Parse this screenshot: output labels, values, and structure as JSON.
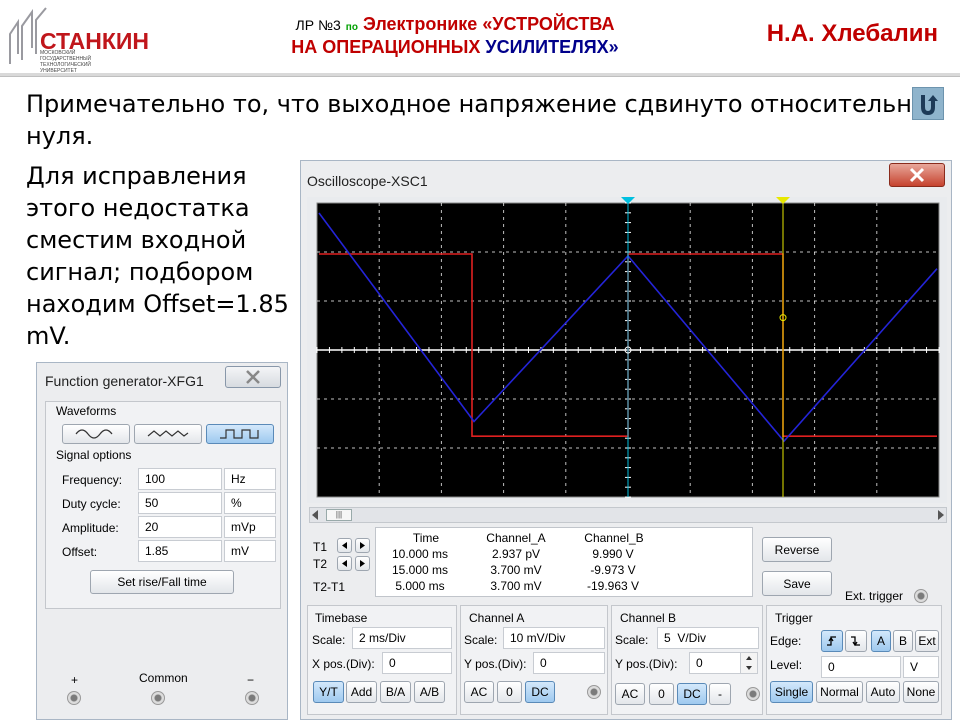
{
  "header": {
    "logo_text": "СТАНКИН",
    "logo_subtitle": "МОСКОВСКИЙ ГОСУДАРСТВЕННЫЙ ТЕХНОЛОГИЧЕСКИЙ УНИВЕРСИТЕТ",
    "lr": "ЛР №3",
    "po": "по",
    "subject": "Электронике",
    "title_part1": "«УСТРОЙСТВА",
    "title_part2a": "НА ОПЕРАЦИОННЫХ",
    "title_part2b": "УСИЛИТЕЛЯХ»",
    "author": "Н.А. Хлебалин"
  },
  "body": {
    "line1": "Примечательно то, что выходное напряжение сдвинуто относительно",
    "line2": "нуля.",
    "side_lines": [
      "Для исправления",
      "этого недостатка",
      "сместим входной",
      "сигнал; подбором",
      "находим Offset=1.85",
      "mV."
    ]
  },
  "function_generator": {
    "title": "Function generator-XFG1",
    "waveforms_label": "Waveforms",
    "selected_waveform": "square",
    "signal_options_label": "Signal options",
    "fields": [
      {
        "label": "Frequency:",
        "value": "100",
        "unit": "Hz"
      },
      {
        "label": "Duty cycle:",
        "value": "50",
        "unit": "%"
      },
      {
        "label": "Amplitude:",
        "value": "20",
        "unit": "mVp"
      },
      {
        "label": "Offset:",
        "value": "1.85",
        "unit": "mV"
      }
    ],
    "rise_fall_button": "Set rise/Fall time",
    "terminals": {
      "plus": "+",
      "common": "Common",
      "minus": "−"
    }
  },
  "oscilloscope": {
    "title": "Oscilloscope-XSC1",
    "scroll_label": "|||",
    "cursors": {
      "t1": "T1",
      "t2": "T2",
      "t2t1": "T2-T1"
    },
    "readout": {
      "headers": [
        "Time",
        "Channel_A",
        "Channel_B"
      ],
      "rows": [
        [
          "10.000 ms",
          "2.937 pV",
          "9.990 V"
        ],
        [
          "15.000 ms",
          "3.700 mV",
          "-9.973 V"
        ],
        [
          "5.000 ms",
          "3.700 mV",
          "-19.963 V"
        ]
      ]
    },
    "reverse_button": "Reverse",
    "save_button": "Save",
    "ext_trigger_label": "Ext. trigger",
    "timebase": {
      "label": "Timebase",
      "scale_label": "Scale:",
      "scale": "2 ms/Div",
      "xpos_label": "X pos.(Div):",
      "xpos": "0",
      "buttons": [
        "Y/T",
        "Add",
        "B/A",
        "A/B"
      ],
      "active": "Y/T"
    },
    "channel_a": {
      "label": "Channel A",
      "scale_label": "Scale:",
      "scale": "10 mV/Div",
      "ypos_label": "Y pos.(Div):",
      "ypos": "0",
      "buttons": [
        "AC",
        "0",
        "DC"
      ],
      "active": "DC"
    },
    "channel_b": {
      "label": "Channel B",
      "scale_label": "Scale:",
      "scale": "5  V/Div",
      "ypos_label": "Y pos.(Div):",
      "ypos": "0",
      "buttons": [
        "AC",
        "0",
        "DC",
        "-"
      ],
      "active": "DC"
    },
    "trigger": {
      "label": "Trigger",
      "edge_label": "Edge:",
      "edge_buttons": [
        "A",
        "B",
        "Ext"
      ],
      "level_label": "Level:",
      "level": "0",
      "level_unit": "V",
      "mode_buttons": [
        "Single",
        "Normal",
        "Auto",
        "None"
      ],
      "active": "Single"
    },
    "colors": {
      "channel_a": "#2424d8",
      "channel_b": "#e02020",
      "t1_cursor": "#00c0e0",
      "t2_cursor": "#e8e800",
      "screen": "#000000",
      "grid": "#ffffff"
    }
  }
}
